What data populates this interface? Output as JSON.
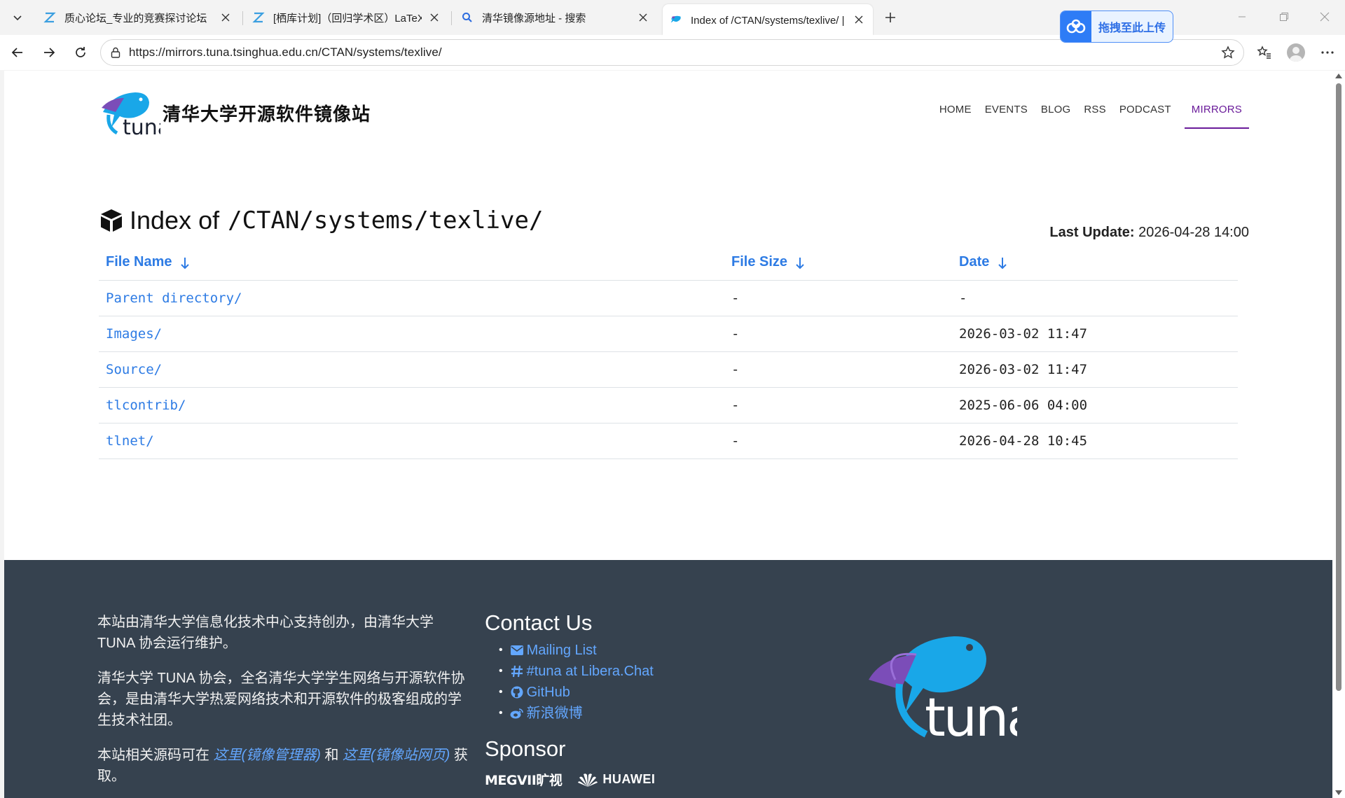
{
  "browser": {
    "tabs": [
      {
        "title": "质心论坛_专业的竞赛探讨论坛",
        "favicon": "z-logo-icon"
      },
      {
        "title": "[栖库计划]（回归学术区）LaTeX:",
        "favicon": "z-logo-icon"
      },
      {
        "title": "清华镜像源地址 - 搜索",
        "favicon": "search-icon"
      },
      {
        "title": "Index of /CTAN/systems/texlive/ | 清",
        "favicon": "tuna-fish-icon"
      }
    ],
    "active_tab": 3,
    "url": "https://mirrors.tuna.tsinghua.edu.cn/CTAN/systems/texlive/",
    "baidu_upload_label": "拖拽至此上传"
  },
  "site": {
    "name": "清华大学开源软件镜像站",
    "nav": [
      "HOME",
      "EVENTS",
      "BLOG",
      "RSS",
      "PODCAST",
      "MIRRORS"
    ],
    "active_nav": "MIRRORS"
  },
  "index": {
    "title_prefix": "Index of",
    "path": "/CTAN/systems/texlive/",
    "last_update_label": "Last Update:",
    "last_update_value": "2026-04-28 14:00",
    "columns": [
      "File Name",
      "File Size",
      "Date"
    ],
    "rows": [
      {
        "name": "Parent directory/",
        "size": "-",
        "date": "-"
      },
      {
        "name": "Images/",
        "size": "-",
        "date": "2026-03-02 11:47"
      },
      {
        "name": "Source/",
        "size": "-",
        "date": "2026-03-02 11:47"
      },
      {
        "name": "tlcontrib/",
        "size": "-",
        "date": "2025-06-06 04:00"
      },
      {
        "name": "tlnet/",
        "size": "-",
        "date": "2026-04-28 10:45"
      }
    ]
  },
  "footer": {
    "p1": "本站由清华大学信息化技术中心支持创办，由清华大学 TUNA 协会运行维护。",
    "p2": "清华大学 TUNA 协会，全名清华大学学生网络与开源软件协会，是由清华大学热爱网络技术和开源软件的极客组成的学生技术社团。",
    "p3_prefix": "本站相关源码可在",
    "p3_link1": "这里(镜像管理器)",
    "p3_and": "和",
    "p3_link2": "这里(镜像站网页)",
    "p3_suffix": "获取。",
    "contact_heading": "Contact Us",
    "contacts": [
      {
        "label": "Mailing List",
        "icon": "envelope-icon"
      },
      {
        "label": "#tuna at Libera.Chat",
        "icon": "hashtag-icon"
      },
      {
        "label": "GitHub",
        "icon": "github-icon"
      },
      {
        "label": "新浪微博",
        "icon": "weibo-icon"
      }
    ],
    "sponsor_heading": "Sponsor",
    "sponsors": [
      "MEGVII旷视",
      "HUAWEI"
    ]
  },
  "colors": {
    "link": "#2d7be4",
    "nav_active": "#6a1b9a",
    "footer_bg": "#36424f",
    "footer_link": "#63a7ff"
  }
}
